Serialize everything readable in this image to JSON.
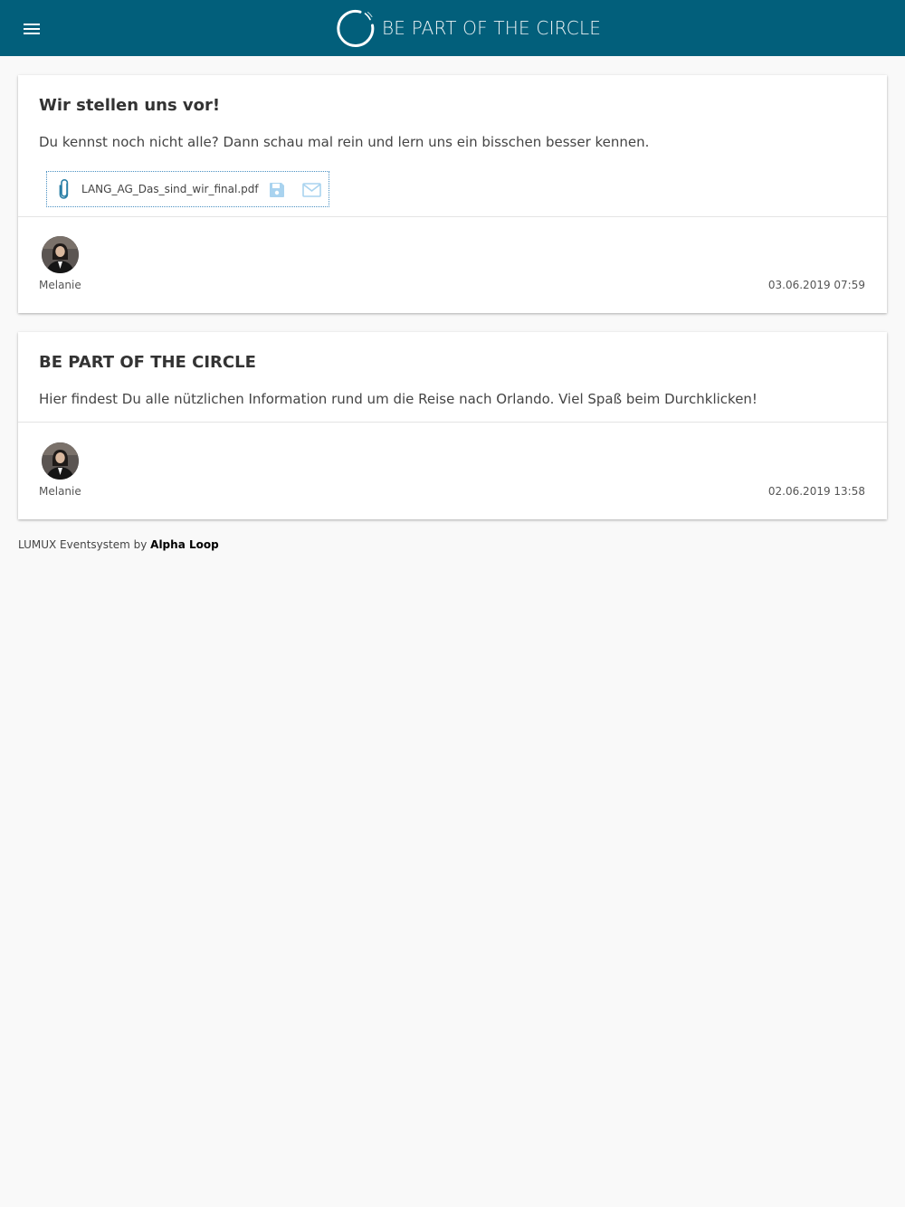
{
  "header": {
    "brand_text": "BE PART OF THE CIRCLE",
    "background_color": "#025f7b",
    "menu_icon": "hamburger-menu-icon",
    "logo_icon": "circle-logo-icon"
  },
  "posts": [
    {
      "title": "Wir stellen uns vor!",
      "text": "Du kennst noch nicht alle? Dann schau mal rein und lern uns ein bisschen besser kennen.",
      "attachment": {
        "filename": "LANG_AG_Das_sind_wir_final.pdf",
        "icon": "paperclip-icon",
        "actions": [
          "save-icon",
          "mail-icon"
        ]
      },
      "author": "Melanie",
      "timestamp": "03.06.2019 07:59"
    },
    {
      "title": "BE PART OF THE CIRCLE",
      "text": "Hier findest Du alle nützlichen Information rund um die Reise nach Orlando. Viel Spaß beim Durchklicken!",
      "author": "Melanie",
      "timestamp": "02.06.2019 13:58"
    }
  ],
  "footer": {
    "prefix": "LUMUX Eventsystem by ",
    "link_text": "Alpha Loop"
  }
}
